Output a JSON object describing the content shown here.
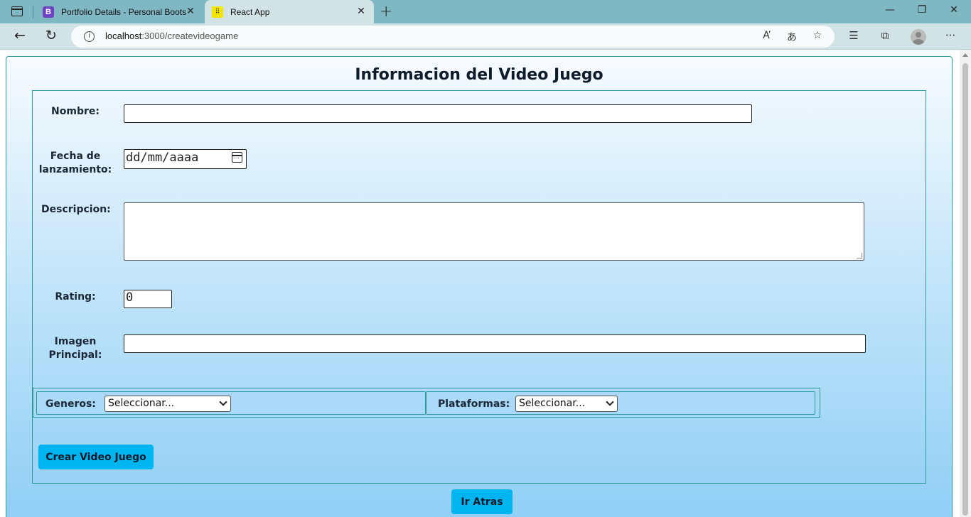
{
  "browser": {
    "tabs": [
      {
        "title": "Portfolio Details - Personal Boots",
        "favicon": "B"
      },
      {
        "title": "React App",
        "favicon": "⠿"
      }
    ],
    "url_host": "localhost",
    "url_path": ":3000/createvideogame",
    "toolbar_icons": [
      "read-aloud-icon",
      "translate-icon",
      "favorites-add-icon",
      "favorites-icon",
      "collections-icon",
      "profile-icon",
      "more-icon"
    ]
  },
  "form": {
    "title": "Informacion del Video Juego",
    "nombre_label": "Nombre:",
    "nombre_value": "",
    "fecha_label_line1": "Fecha de",
    "fecha_label_line2": "lanzamiento:",
    "fecha_placeholder": "dd/mm/aaaa",
    "descripcion_label": "Descripcion:",
    "descripcion_value": "",
    "rating_label": "Rating:",
    "rating_value": "0",
    "imagen_label_line1": "Imagen",
    "imagen_label_line2": "Principal:",
    "imagen_value": "",
    "generos_label": "Generos:",
    "generos_selected": "Seleccionar...",
    "plataformas_label": "Plataformas:",
    "plataformas_selected": "Seleccionar...",
    "submit_label": "Crear Video Juego"
  },
  "back_button_label": "Ir Atras",
  "colors": {
    "accent_button": "#00b4f0",
    "border_teal": "#2b9a9a",
    "gradient_bottom": "#8fcef5"
  }
}
